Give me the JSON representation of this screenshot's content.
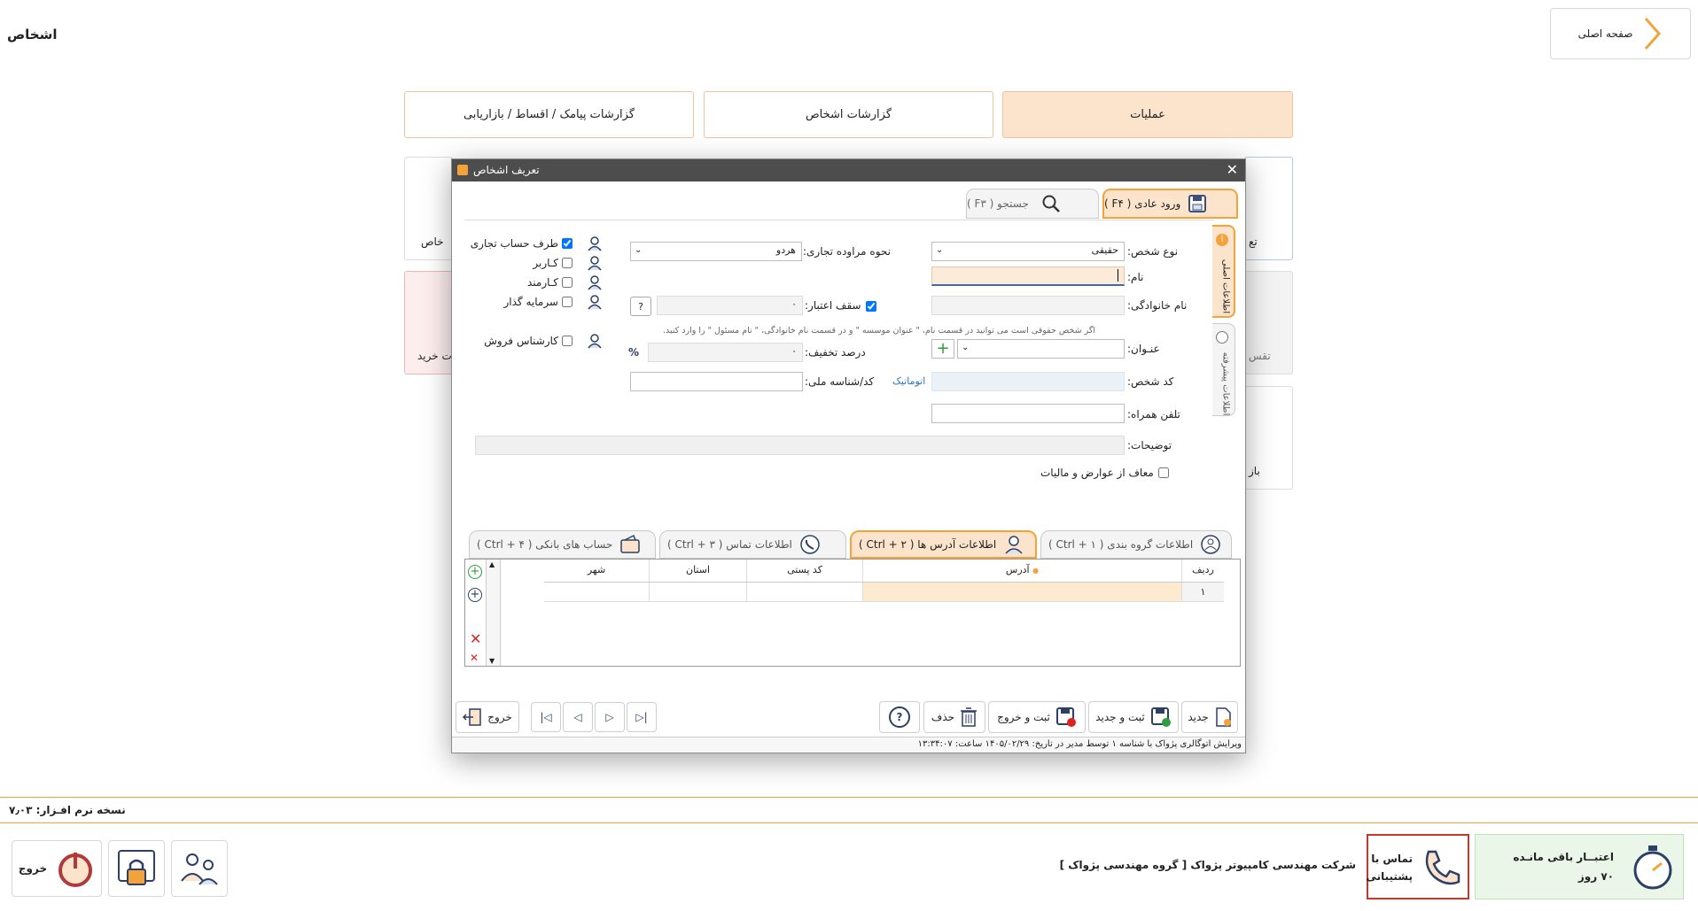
{
  "page_title": "اشخاص",
  "home_button": "صفحه اصلی",
  "top_tabs": [
    "عملیات",
    "گزارشات اشخاص",
    "گزارشات پیامک / اقساط / بازاریابی"
  ],
  "bg_fragments": {
    "left1": "خاص",
    "left2": "ت خرید",
    "right1": "تع",
    "right2": "تقس",
    "right3": "باز"
  },
  "dialog": {
    "title": "تعریف اشخاص",
    "mode_tabs": {
      "normal": "ورود عادی ( F۴ )",
      "search": "جستجو ( F۳ )"
    },
    "side_tabs": {
      "main": "اطلاعات اصلی",
      "advanced": "اطلاعات پیشرفته"
    },
    "fields": {
      "person_type_label": "نوع شخص:",
      "person_type_value": "حقیقی",
      "trade_type_label": "نحوه مراوده تجاری:",
      "trade_type_value": "هردو",
      "name_label": "نام:",
      "family_label": "نام خانوادگی:",
      "credit_label": "سقف اعتبار:",
      "credit_value": "۰",
      "hint": "اگر شخص حقوقی است می توانید در قسمت نام، \" عنوان موسسه \" و در قسمت نام خانوادگی، \" نام مسئول \" را وارد کنید.",
      "title_label": "عنـوان:",
      "discount_label": "درصد تخفیف:",
      "discount_value": "۰",
      "percent_sign": "%",
      "code_label": "کد شخص:",
      "code_auto": "اتوماتیک",
      "national_label": "کد/شناسه ملی:",
      "mobile_label": "تلفن همراه:",
      "desc_label": "توضیحات:",
      "tax_exempt_label": "معاف از عوارض و مالیات"
    },
    "roles": [
      {
        "label": "طرف حساب تجاری",
        "checked": true
      },
      {
        "label": "کـاربر",
        "checked": false
      },
      {
        "label": "کـارمند",
        "checked": false
      },
      {
        "label": "سرمایه گذار",
        "checked": false
      },
      {
        "label": "کارشناس فروش",
        "checked": false
      }
    ],
    "bottom_tabs": [
      "اطلاعات گروه بندی ( Ctrl + ۱ )",
      "اطلاعات آدرس ها ( Ctrl + ۲ )",
      "اطلاعات تماس ( Ctrl + ۳ )",
      "حساب های بانکی ( Ctrl + ۴ )"
    ],
    "grid": {
      "headers": [
        "ردیف",
        "آدرس",
        "کد پستی",
        "استان",
        "شهر"
      ],
      "rows": [
        [
          "۱",
          "",
          "",
          "",
          ""
        ]
      ]
    },
    "footer_buttons": {
      "new": "جدید",
      "save_new": "ثبت و جدید",
      "save_exit": "ثبت و خروج",
      "delete": "حذف",
      "exit": "خروج"
    },
    "status": "ویرایش  اتوگالری پژواک با شناسه ۱ توسط مدیر در تاریخ: ۱۴۰۵/۰۲/۲۹ ساعت: ۱۳:۳۴:۰۷"
  },
  "version": "نسخه نرم افـزار: ۷٫۰۳",
  "bottom": {
    "credit_title": "اعتبــار باقی مانـده",
    "credit_days": "۷۰ روز",
    "support": "تماس با پشتیبانی",
    "company": "شرکت مهندسی کامپیوتر پژواک [ گروه مهندسی پژواک ]",
    "exit": "خروج"
  },
  "colors": {
    "accent": "#f2a33c",
    "tab_active_bg": "#fbe3cc",
    "title_bar": "#4d4d4d",
    "support_border": "#c0392b",
    "credit_bg": "#eaf6e8"
  }
}
